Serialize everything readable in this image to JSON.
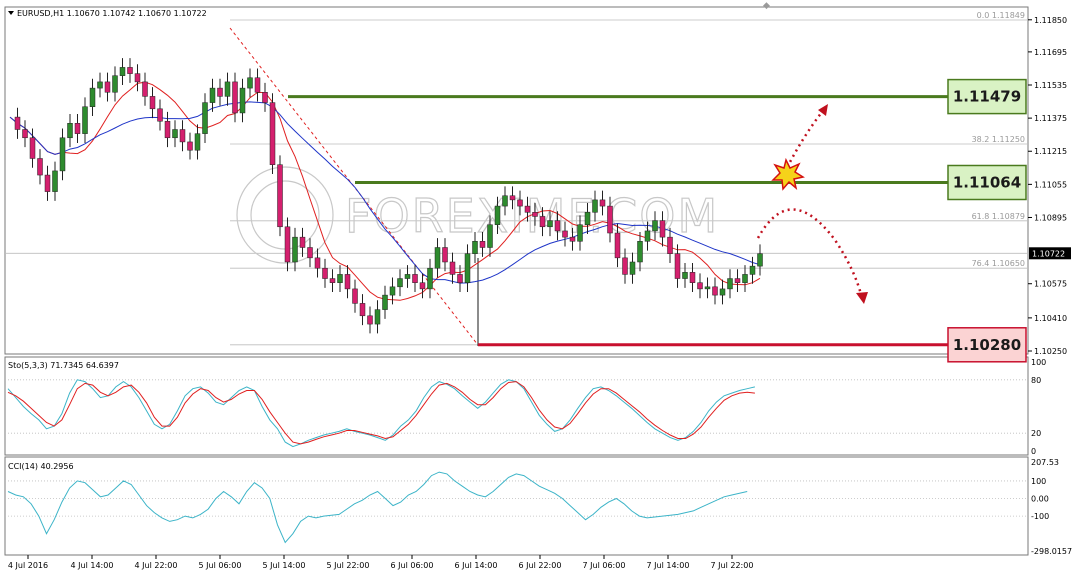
{
  "chart_data": {
    "type": "candlestick",
    "symbol_header": "EURUSD,H1  1.10670 1.10742 1.10670 1.10722",
    "colors": {
      "bull": "#2e8b2e",
      "bear": "#d4206e",
      "ma_fast": "#e02020",
      "ma_slow": "#1f35c8",
      "stoch_main": "#3cb4c8",
      "stoch_signal": "#e02020",
      "cci": "#3cb4c8",
      "support_line": "#c8102e",
      "resistance_line": "#4a7a1e"
    },
    "price_axis": {
      "ticks": [
        "1.11850",
        "1.11695",
        "1.11535",
        "1.11375",
        "1.11215",
        "1.11055",
        "1.10895",
        "1.10722",
        "1.10575",
        "1.10410",
        "1.10250"
      ],
      "ylim": [
        1.102,
        1.1192
      ],
      "current_price": "1.10722"
    },
    "time_axis": [
      "4 Jul 2016",
      "4 Jul 14:00",
      "4 Jul 22:00",
      "5 Jul 06:00",
      "5 Jul 14:00",
      "5 Jul 22:00",
      "6 Jul 06:00",
      "6 Jul 14:00",
      "6 Jul 22:00",
      "7 Jul 06:00",
      "7 Jul 14:00",
      "7 Jul 22:00"
    ],
    "fibonacci": [
      {
        "label": "0.0  1.11849",
        "price": 1.11849
      },
      {
        "label": "38.2  1.11250",
        "price": 1.1125
      },
      {
        "label": "61.8  1.10879",
        "price": 1.10879
      },
      {
        "label": "76.4  1.10650",
        "price": 1.1065
      }
    ],
    "levels": [
      {
        "label": "1.11479",
        "price": 1.11479,
        "kind": "resistance"
      },
      {
        "label": "1.11064",
        "price": 1.11064,
        "kind": "resistance"
      },
      {
        "label": "1.10280",
        "price": 1.1028,
        "kind": "support"
      }
    ],
    "close_path": [
      1.1138,
      1.1132,
      1.1128,
      1.1118,
      1.111,
      1.1102,
      1.1112,
      1.1128,
      1.1135,
      1.113,
      1.1143,
      1.1152,
      1.1155,
      1.115,
      1.1158,
      1.1162,
      1.1159,
      1.1155,
      1.1148,
      1.1142,
      1.1136,
      1.1128,
      1.1132,
      1.1126,
      1.1122,
      1.113,
      1.1145,
      1.1152,
      1.1148,
      1.1155,
      1.114,
      1.1152,
      1.1157,
      1.115,
      1.1145,
      1.1115,
      1.1085,
      1.1068,
      1.108,
      1.1075,
      1.107,
      1.1065,
      1.106,
      1.1058,
      1.1062,
      1.1055,
      1.1048,
      1.1042,
      1.1038,
      1.1045,
      1.1052,
      1.1056,
      1.106,
      1.1062,
      1.1058,
      1.1055,
      1.1065,
      1.1075,
      1.1068,
      1.1062,
      1.1058,
      1.1072,
      1.1078,
      1.1075,
      1.1086,
      1.1095,
      1.11,
      1.1098,
      1.1095,
      1.1092,
      1.109,
      1.1085,
      1.1088,
      1.1083,
      1.108,
      1.1078,
      1.1086,
      1.1092,
      1.1098,
      1.1095,
      1.1082,
      1.107,
      1.1062,
      1.1068,
      1.1078,
      1.1083,
      1.1088,
      1.108,
      1.1072,
      1.106,
      1.1063,
      1.1058,
      1.1055,
      1.1056,
      1.1052,
      1.1055,
      1.106,
      1.1058,
      1.1062,
      1.1066,
      1.1072
    ],
    "stochastic": {
      "label": "Sto(5,3,3) 71.7345 64.6397",
      "ticks": [
        "100",
        "80",
        "20",
        "0"
      ],
      "main": [
        70,
        60,
        50,
        42,
        35,
        25,
        28,
        42,
        65,
        80,
        78,
        70,
        60,
        62,
        72,
        78,
        72,
        60,
        45,
        30,
        25,
        30,
        45,
        62,
        70,
        72,
        65,
        55,
        52,
        60,
        68,
        72,
        68,
        50,
        35,
        25,
        10,
        5,
        8,
        12,
        15,
        18,
        20,
        22,
        25,
        22,
        20,
        18,
        15,
        12,
        18,
        28,
        35,
        45,
        60,
        72,
        78,
        75,
        70,
        62,
        55,
        48,
        55,
        65,
        75,
        80,
        78,
        70,
        55,
        40,
        30,
        22,
        25,
        35,
        48,
        60,
        70,
        72,
        68,
        62,
        55,
        48,
        40,
        32,
        25,
        20,
        15,
        12,
        15,
        22,
        32,
        45,
        55,
        62,
        65,
        68,
        70,
        72
      ],
      "signal": [
        66,
        62,
        56,
        48,
        40,
        32,
        28,
        35,
        52,
        70,
        76,
        74,
        66,
        62,
        66,
        72,
        74,
        66,
        54,
        38,
        28,
        28,
        38,
        54,
        64,
        70,
        68,
        60,
        55,
        58,
        64,
        68,
        68,
        58,
        44,
        32,
        20,
        10,
        8,
        10,
        13,
        16,
        18,
        20,
        23,
        23,
        21,
        19,
        17,
        14,
        16,
        23,
        30,
        40,
        52,
        64,
        74,
        76,
        72,
        66,
        58,
        52,
        52,
        60,
        70,
        77,
        78,
        72,
        60,
        46,
        35,
        27,
        25,
        31,
        42,
        54,
        64,
        70,
        70,
        65,
        58,
        51,
        44,
        36,
        29,
        23,
        18,
        14,
        14,
        19,
        27,
        38,
        48,
        57,
        62,
        65,
        66,
        65
      ]
    },
    "cci": {
      "label": "CCI(14) 40.2956",
      "ticks": [
        "207.53",
        "100",
        "0.00",
        "-100",
        "-298.01571"
      ],
      "values": [
        40,
        20,
        10,
        -30,
        -100,
        -200,
        -120,
        -20,
        60,
        100,
        90,
        50,
        10,
        20,
        60,
        100,
        80,
        20,
        -40,
        -80,
        -110,
        -130,
        -120,
        -100,
        -110,
        -90,
        -60,
        0,
        40,
        10,
        -30,
        40,
        90,
        60,
        0,
        -150,
        -250,
        -200,
        -130,
        -100,
        -110,
        -100,
        -95,
        -90,
        -60,
        -30,
        -10,
        20,
        40,
        0,
        -40,
        -20,
        20,
        40,
        80,
        130,
        150,
        140,
        100,
        70,
        40,
        20,
        10,
        40,
        80,
        120,
        140,
        130,
        100,
        70,
        50,
        30,
        0,
        -40,
        -80,
        -120,
        -90,
        -50,
        -20,
        0,
        -30,
        -70,
        -100,
        -110,
        -105,
        -100,
        -95,
        -90,
        -80,
        -70,
        -50,
        -30,
        -10,
        10,
        20,
        30,
        40
      ]
    },
    "watermark": "FOREXIMF.COM"
  }
}
